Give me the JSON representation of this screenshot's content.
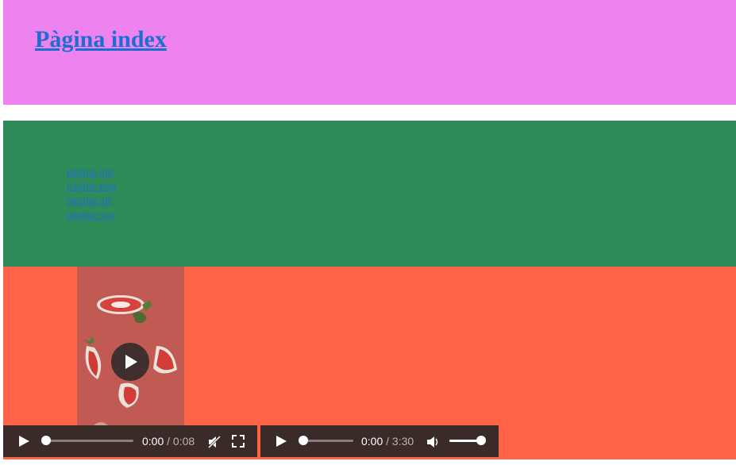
{
  "header": {
    "title": "Pàgina index"
  },
  "nav": {
    "links": [
      {
        "label": "pàgina jpg"
      },
      {
        "label": "pàgina png"
      },
      {
        "label": "pàgina gif"
      },
      {
        "label": "pàgina svg"
      }
    ]
  },
  "colors": {
    "header_bg": "#ee82ee",
    "nav_bg": "#2e8b57",
    "media_bg": "#ff6347",
    "link": "#1a6fd0"
  },
  "video": {
    "current_time": "0:00",
    "separator": "/",
    "duration": "0:08",
    "progress": 0,
    "muted": true
  },
  "audio": {
    "current_time": "0:00",
    "separator": "/",
    "duration": "3:30",
    "progress": 0,
    "volume": 1
  }
}
